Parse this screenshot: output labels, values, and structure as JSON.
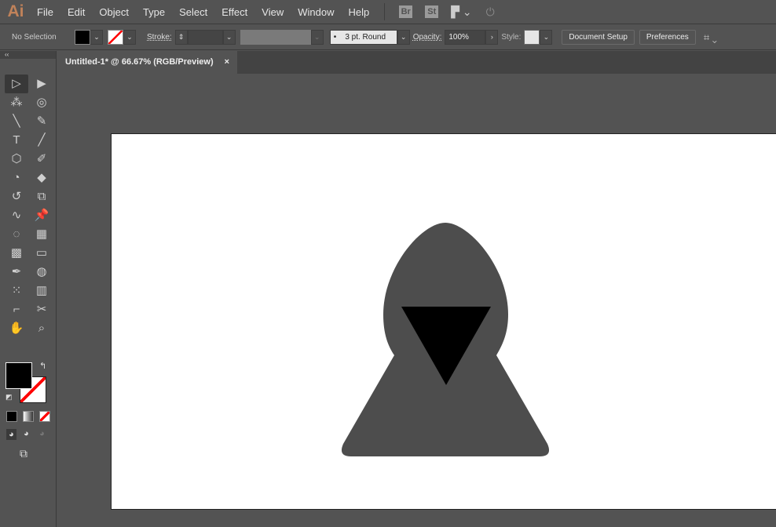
{
  "app": {
    "logo": "Ai"
  },
  "menu": [
    "File",
    "Edit",
    "Object",
    "Type",
    "Select",
    "Effect",
    "View",
    "Window",
    "Help"
  ],
  "appbar": {
    "bridge": "Br",
    "stock": "St",
    "layout_icon": "workspace-layout-icon",
    "sync_icon": "gpu-rocket-icon"
  },
  "control": {
    "selection": "No Selection",
    "fill_color": "#000000",
    "stroke_label": "Stroke:",
    "brush": "3 pt. Round",
    "opacity_label": "Opacity:",
    "opacity": "100%",
    "style_label": "Style:",
    "document_setup": "Document Setup",
    "preferences": "Preferences"
  },
  "document": {
    "tab_title": "Untitled-1* @ 66.67% (RGB/Preview)",
    "close": "×"
  },
  "toolbox": {
    "tools": [
      [
        "selection-tool",
        "▷"
      ],
      [
        "direct-selection-tool",
        "▶"
      ],
      [
        "magic-wand-tool",
        "⁂"
      ],
      [
        "lasso-tool",
        "◎"
      ],
      [
        "pen-tool",
        "╲"
      ],
      [
        "curvature-tool",
        "✎"
      ],
      [
        "type-tool",
        "T"
      ],
      [
        "line-tool",
        "╱"
      ],
      [
        "polygon-tool",
        "⬡"
      ],
      [
        "paintbrush-tool",
        "✐"
      ],
      [
        "shaper-tool",
        "◔"
      ],
      [
        "eraser-tool",
        "◆"
      ],
      [
        "rotate-tool",
        "↺"
      ],
      [
        "scale-tool",
        "⧉"
      ],
      [
        "warp-tool",
        "∿"
      ],
      [
        "puppet-warp-tool",
        "📌"
      ],
      [
        "shape-builder-tool",
        "◌"
      ],
      [
        "perspective-grid-tool",
        "▦"
      ],
      [
        "mesh-tool",
        "▩"
      ],
      [
        "gradient-tool",
        "▭"
      ],
      [
        "eyedropper-tool",
        "✒"
      ],
      [
        "blend-tool",
        "◍"
      ],
      [
        "symbol-sprayer-tool",
        "⁙"
      ],
      [
        "column-graph-tool",
        "▥"
      ],
      [
        "artboard-tool",
        "⌐"
      ],
      [
        "slice-tool",
        "✂"
      ],
      [
        "hand-tool",
        "✋"
      ],
      [
        "zoom-tool",
        "⌕"
      ]
    ]
  },
  "colors": {
    "hood": "#4d4d4d",
    "face": "#000000",
    "artboard": "#ffffff"
  }
}
